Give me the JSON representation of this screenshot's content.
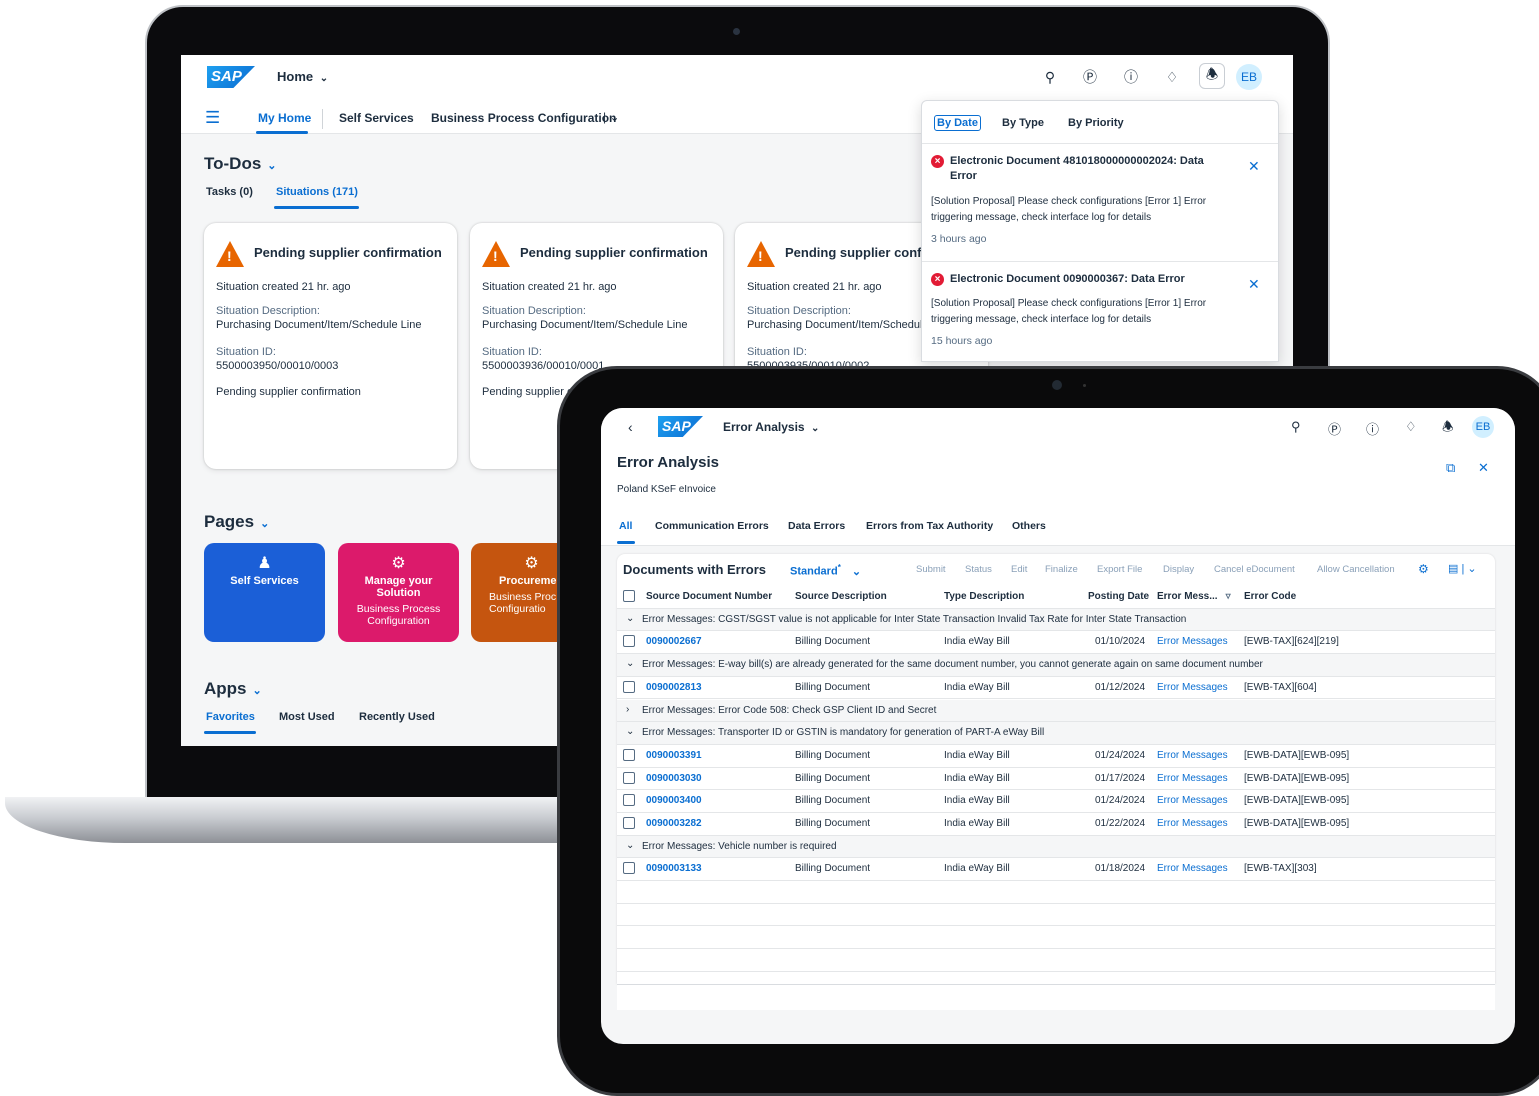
{
  "laptop": {
    "shell": {
      "logo": "SAP",
      "home_label": "Home",
      "avatar": "EB"
    },
    "nav": {
      "items": [
        "My Home",
        "Self Services",
        "Business Process Configuration"
      ]
    },
    "todos": {
      "title": "To-Dos",
      "tabs": [
        "Tasks (0)",
        "Situations (171)"
      ],
      "cards": [
        {
          "title": "Pending supplier confirmation",
          "created": "Situation created 21 hr. ago",
          "desc_label": "Situation Description:",
          "desc": "Purchasing Document/Item/Schedule Line",
          "id_label": "Situation ID:",
          "id": "5500003950/00010/0003",
          "footer": "Pending supplier confirmation"
        },
        {
          "title": "Pending supplier confirmation",
          "created": "Situation created 21 hr. ago",
          "desc_label": "Situation Description:",
          "desc": "Purchasing Document/Item/Schedule Line",
          "id_label": "Situation ID:",
          "id": "5500003936/00010/0001",
          "footer": "Pending supplier c"
        },
        {
          "title": "Pending supplier confi",
          "created": "Situation created 21 hr. ago",
          "desc_label": "Situation Description:",
          "desc": "Purchasing Document/Item/Schedul",
          "id_label": "Situation ID:",
          "id": "5500003935/00010/0002",
          "footer": ""
        }
      ]
    },
    "pages": {
      "title": "Pages",
      "tiles": [
        {
          "title": "Self Services",
          "sub": "",
          "color": "#1b5fd7"
        },
        {
          "title": "Manage your Solution",
          "sub": "Business Process Configuration",
          "color": "#dc1a6b"
        },
        {
          "title": "Procureme",
          "sub": "Business Proc Configuratio",
          "color": "#c5550f"
        }
      ]
    },
    "apps": {
      "title": "Apps",
      "tabs": [
        "Favorites",
        "Most Used",
        "Recently Used"
      ]
    },
    "notifications": {
      "tabs": [
        "By Date",
        "By Type",
        "By Priority"
      ],
      "items": [
        {
          "title": "Electronic Document 481018000000002024: Data Error",
          "body": "[Solution Proposal] Please check configurations [Error 1] Error triggering message, check interface log for details",
          "time": "3 hours ago"
        },
        {
          "title": "Electronic Document 0090000367: Data Error",
          "body": "[Solution Proposal] Please check configurations [Error 1] Error triggering message, check interface log for details",
          "time": "15 hours ago"
        }
      ]
    }
  },
  "tablet": {
    "shell": {
      "logo": "SAP",
      "app_title": "Error Analysis",
      "avatar": "EB"
    },
    "header": {
      "title": "Error Analysis",
      "subtitle": "Poland KSeF eInvoice"
    },
    "filter_tabs": [
      "All",
      "Communication Errors",
      "Data Errors",
      "Errors from Tax Authority",
      "Others"
    ],
    "table": {
      "title": "Documents with Errors",
      "variant": "Standard",
      "variant_marker": "*",
      "actions": [
        "Submit",
        "Status",
        "Edit",
        "Finalize",
        "Export File",
        "Display",
        "Cancel eDocument",
        "Allow Cancellation"
      ],
      "columns": [
        "Source Document Number",
        "Source Description",
        "Type Description",
        "Posting Date",
        "Error Mess...",
        "Error Code"
      ],
      "rows": [
        {
          "type": "group",
          "expanded": true,
          "text": "Error Messages: CGST/SGST value is not applicable for Inter State Transaction Invalid Tax Rate for Inter State Transaction"
        },
        {
          "type": "data",
          "num": "0090002667",
          "src": "Billing Document",
          "typ": "India eWay Bill",
          "date": "01/10/2024",
          "msg": "Error Messages",
          "code": "[EWB-TAX][624][219]"
        },
        {
          "type": "group",
          "expanded": true,
          "text": "Error Messages: E-way bill(s) are already generated for the same document number, you cannot generate again on same document number"
        },
        {
          "type": "data",
          "num": "0090002813",
          "src": "Billing Document",
          "typ": "India eWay Bill",
          "date": "01/12/2024",
          "msg": "Error Messages",
          "code": "[EWB-TAX][604]"
        },
        {
          "type": "group",
          "expanded": false,
          "text": "Error Messages: Error Code 508: Check GSP Client ID and Secret"
        },
        {
          "type": "group",
          "expanded": true,
          "text": "Error Messages: Transporter ID or GSTIN is mandatory for generation of PART-A eWay Bill"
        },
        {
          "type": "data",
          "num": "0090003391",
          "src": "Billing Document",
          "typ": "India eWay Bill",
          "date": "01/24/2024",
          "msg": "Error Messages",
          "code": "[EWB-DATA][EWB-095]"
        },
        {
          "type": "data",
          "num": "0090003030",
          "src": "Billing Document",
          "typ": "India eWay Bill",
          "date": "01/17/2024",
          "msg": "Error Messages",
          "code": "[EWB-DATA][EWB-095]"
        },
        {
          "type": "data",
          "num": "0090003400",
          "src": "Billing Document",
          "typ": "India eWay Bill",
          "date": "01/24/2024",
          "msg": "Error Messages",
          "code": "[EWB-DATA][EWB-095]"
        },
        {
          "type": "data",
          "num": "0090003282",
          "src": "Billing Document",
          "typ": "India eWay Bill",
          "date": "01/22/2024",
          "msg": "Error Messages",
          "code": "[EWB-DATA][EWB-095]"
        },
        {
          "type": "group",
          "expanded": true,
          "text": "Error Messages: Vehicle number is required"
        },
        {
          "type": "data",
          "num": "0090003133",
          "src": "Billing Document",
          "typ": "India eWay Bill",
          "date": "01/18/2024",
          "msg": "Error Messages",
          "code": "[EWB-TAX][303]"
        }
      ]
    }
  },
  "colors": {
    "accent": "#0a6ed1",
    "error": "#e21b35",
    "warning": "#e76500"
  },
  "icons": [
    "search-icon",
    "copilot-icon",
    "help-icon",
    "diamond-icon",
    "bell-icon",
    "menu-icon",
    "back-icon",
    "open-external-icon",
    "close-icon",
    "settings-icon",
    "filter-icon",
    "export-icon"
  ]
}
